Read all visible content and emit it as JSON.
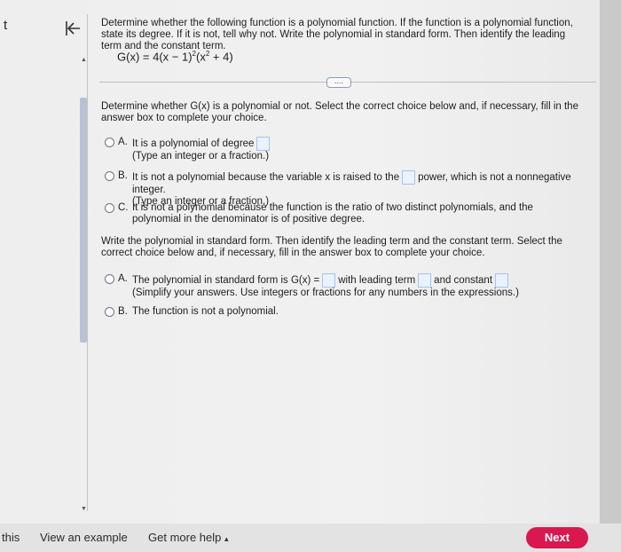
{
  "left_fragment": "t",
  "question": {
    "prompt": "Determine whether the following function is a polynomial function. If the function is a polynomial function, state its degree. If it is not, tell why not. Write the polynomial in standard form. Then identify the leading term and the constant term.",
    "function_lhs": "G(x) = 4(x − 1)",
    "function_exp1": "2",
    "function_mid": "(x",
    "function_exp2": "2",
    "function_rhs": " + 4)"
  },
  "more_label": "....",
  "part1": {
    "instruction": "Determine whether G(x) is a polynomial or not. Select the correct choice below and, if necessary, fill in the answer box to complete your choice.",
    "choices": [
      {
        "letter": "A.",
        "text": "It is a polynomial of degree",
        "hint": "(Type an integer or a fraction.)"
      },
      {
        "letter": "B.",
        "text_before": "It is not a polynomial because the variable x is raised to the",
        "text_after": "power, which is not a nonnegative integer.",
        "hint": "(Type an integer or a fraction.)"
      },
      {
        "letter": "C.",
        "text": "It is not a polynomial because the function is the ratio of two distinct polynomials, and the polynomial in the denominator is of positive degree."
      }
    ]
  },
  "part2": {
    "instruction": "Write the polynomial in standard form. Then identify the leading term and the constant term. Select the correct choice below and, if necessary, fill in the answer box to complete your choice.",
    "choices": [
      {
        "letter": "A.",
        "text_1": "The polynomial in standard form is G(x) =",
        "text_2": "with leading term",
        "text_3": "and constant",
        "hint": "(Simplify your answers. Use integers or fractions for any numbers in the expressions.)"
      },
      {
        "letter": "B.",
        "text": "The function is not a polynomial."
      }
    ]
  },
  "footer": {
    "left_fragment": "this",
    "view_example": "View an example",
    "get_help": "Get more help",
    "get_help_caret": "▴",
    "next": "Next"
  },
  "colors": {
    "next_button": "#d9184f",
    "answer_box_fill": "#eaf1ff",
    "answer_box_border": "#a9c2ec",
    "scroll_thumb": "#b7c3d4"
  }
}
